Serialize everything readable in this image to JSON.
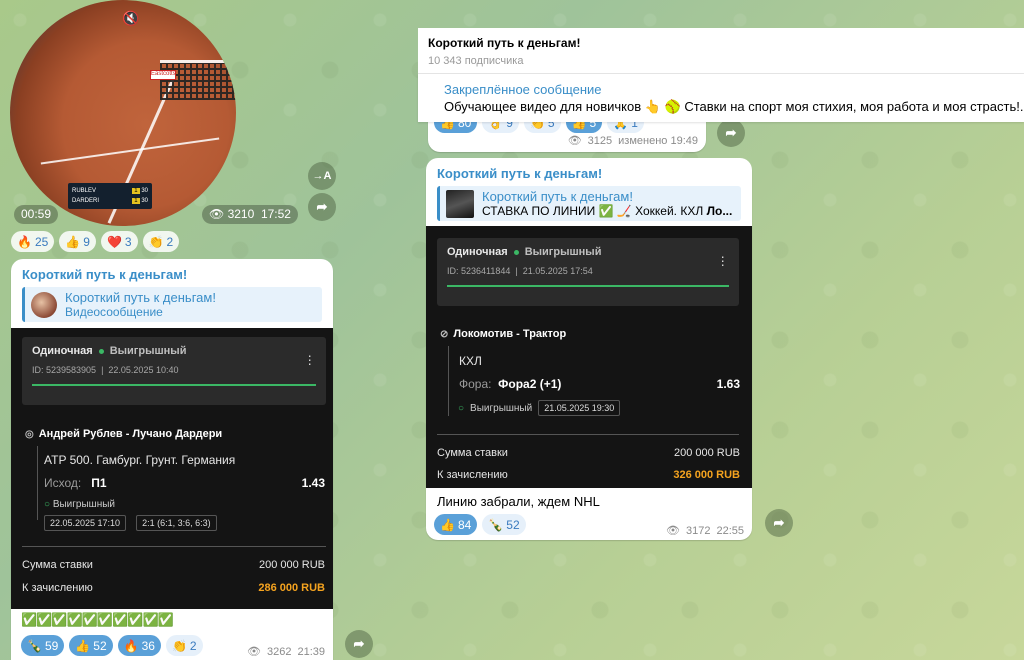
{
  "video": {
    "duration": "00:59",
    "views": "3210",
    "time": "17:52",
    "scoreboard": {
      "player1": "RUBLEV",
      "player2": "DARDERI",
      "p1_game": "1",
      "p1_pts": "30",
      "p2_game": "1",
      "p2_pts": "30"
    },
    "ad_board": "Eastcotts",
    "icons": [
      "mute-icon",
      "translate-icon",
      "share-icon"
    ],
    "translate_label": "→A",
    "reactions": [
      {
        "emoji": "🔥",
        "count": "25"
      },
      {
        "emoji": "👍",
        "count": "9"
      },
      {
        "emoji": "❤️",
        "count": "3"
      },
      {
        "emoji": "👏",
        "count": "2"
      }
    ]
  },
  "post_left": {
    "channel": "Короткий путь к деньгам!",
    "forward_title": "Короткий путь к деньгам!",
    "forward_sub": "Видеосообщение",
    "bet": {
      "type": "Одиночная",
      "status": "Выигрышный",
      "id": "ID: 5239583905",
      "date": "22.05.2025 10:40",
      "match": "Андрей Рублев - Лучано Дардери",
      "league": "ATP 500. Гамбург. Грунт. Германия",
      "outcome_label": "Исход:",
      "outcome": "П1",
      "odds": "1.43",
      "result": "Выигрышный",
      "result_date": "22.05.2025 17:10",
      "score": "2:1 (6:1, 3:6, 6:3)",
      "stake_label": "Сумма ставки",
      "stake": "200 000 RUB",
      "payout_label": "К зачислению",
      "payout": "286 000 RUB"
    },
    "checks": "✅✅✅✅✅✅✅✅✅✅",
    "reactions": [
      {
        "emoji": "🍾",
        "count": "59",
        "active": true
      },
      {
        "emoji": "👍",
        "count": "52",
        "active": true
      },
      {
        "emoji": "🔥",
        "count": "36",
        "active": true
      },
      {
        "emoji": "👏",
        "count": "2",
        "active": false
      }
    ],
    "views": "3262",
    "time": "21:39"
  },
  "header": {
    "title": "Короткий путь к деньгам!",
    "subscribers": "10 343 подписчика"
  },
  "pinned": {
    "title": "Закреплённое сообщение",
    "text": "Обучающее видео для новичков 👆 🥎 Ставки на спорт моя стихия, моя работа и моя страсть!."
  },
  "prev_post": {
    "reactions": [
      {
        "emoji": "👍",
        "count": "80"
      },
      {
        "emoji": "👌",
        "count": "9"
      },
      {
        "emoji": "👏",
        "count": "5"
      },
      {
        "emoji": "👍",
        "count": "5"
      },
      {
        "emoji": "🙏",
        "count": "1"
      }
    ],
    "views": "3125",
    "edited": "изменено 19:49"
  },
  "post_right": {
    "channel": "Короткий путь к деньгам!",
    "forward_title": "Короткий путь к деньгам!",
    "forward_text_a": "СТАВКА ПО ЛИНИИ ✅ 🏒 Хоккей. КХЛ ",
    "forward_text_b": "Ло...",
    "bet": {
      "type": "Одиночная",
      "status": "Выигрышный",
      "id": "ID: 5236411844",
      "date": "21.05.2025 17:54",
      "match": "Локомотив - Трактор",
      "league": "КХЛ",
      "outcome_label": "Фора:",
      "outcome": "Фора2 (+1)",
      "odds": "1.63",
      "result": "Выигрышный",
      "result_date": "21.05.2025 19:30",
      "stake_label": "Сумма ставки",
      "stake": "200 000 RUB",
      "payout_label": "К зачислению",
      "payout": "326 000 RUB"
    },
    "caption": "Линию забрали, ждем NHL",
    "reactions": [
      {
        "emoji": "👍",
        "count": "84",
        "active": true
      },
      {
        "emoji": "🍾",
        "count": "52",
        "active": false
      }
    ],
    "views": "3172",
    "time": "22:55"
  },
  "colors": {
    "accent": "#3a8ec8",
    "win": "#3bb865",
    "payout": "#f5a31f"
  }
}
